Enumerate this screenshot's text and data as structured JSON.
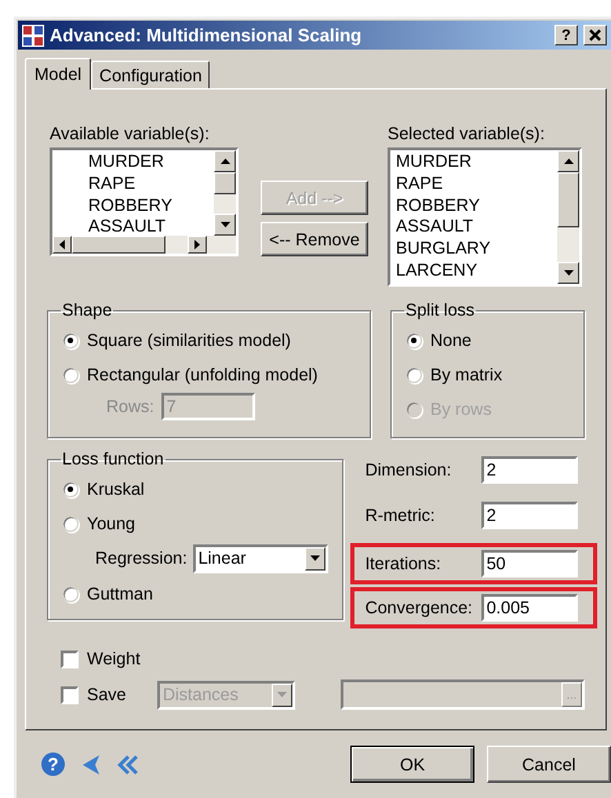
{
  "window": {
    "title": "Advanced: Multidimensional Scaling",
    "help_label": "?"
  },
  "tabs": [
    {
      "label": "Model",
      "selected": true
    },
    {
      "label": "Configuration",
      "selected": false
    }
  ],
  "available": {
    "label": "Available variable(s):",
    "items": [
      "MURDER",
      "RAPE",
      "ROBBERY",
      "ASSAULT"
    ]
  },
  "move_buttons": [
    {
      "label": "Add -->",
      "disabled": true
    },
    {
      "label": "<-- Remove",
      "disabled": false
    }
  ],
  "selected": {
    "label": "Selected variable(s):",
    "items": [
      "MURDER",
      "RAPE",
      "ROBBERY",
      "ASSAULT",
      "BURGLARY",
      "LARCENY"
    ]
  },
  "shape": {
    "title": "Shape",
    "options": [
      {
        "label": "Square (similarities model)",
        "selected": true,
        "disabled": false
      },
      {
        "label": "Rectangular (unfolding model)",
        "selected": false,
        "disabled": false
      }
    ],
    "rows": {
      "label": "Rows:",
      "value": "7",
      "disabled": true
    }
  },
  "split_loss": {
    "title": "Split loss",
    "options": [
      {
        "label": "None",
        "selected": true,
        "disabled": false
      },
      {
        "label": "By matrix",
        "selected": false,
        "disabled": false
      },
      {
        "label": "By rows",
        "selected": false,
        "disabled": true
      }
    ]
  },
  "loss_function": {
    "title": "Loss function",
    "items": [
      {
        "kind": "radio",
        "label": "Kruskal",
        "selected": true
      },
      {
        "kind": "radio",
        "label": "Young",
        "selected": false
      },
      {
        "kind": "combo",
        "label": "Regression:",
        "value": "Linear"
      },
      {
        "kind": "radio",
        "label": "Guttman",
        "selected": false
      }
    ]
  },
  "parameters": [
    {
      "label": "Dimension:",
      "value": "2",
      "highlighted": false
    },
    {
      "label": "R-metric:",
      "value": "2",
      "highlighted": false
    },
    {
      "label": "Iterations:",
      "value": "50",
      "highlighted": true
    },
    {
      "label": "Convergence:",
      "value": "0.005",
      "highlighted": true
    }
  ],
  "weight": {
    "label": "Weight",
    "checked": false
  },
  "save": {
    "label": "Save",
    "checked": false,
    "value": "Distances",
    "disabled": true,
    "browse_label": "..."
  },
  "footer": {
    "help_label": "?",
    "ok": "OK",
    "cancel": "Cancel"
  }
}
